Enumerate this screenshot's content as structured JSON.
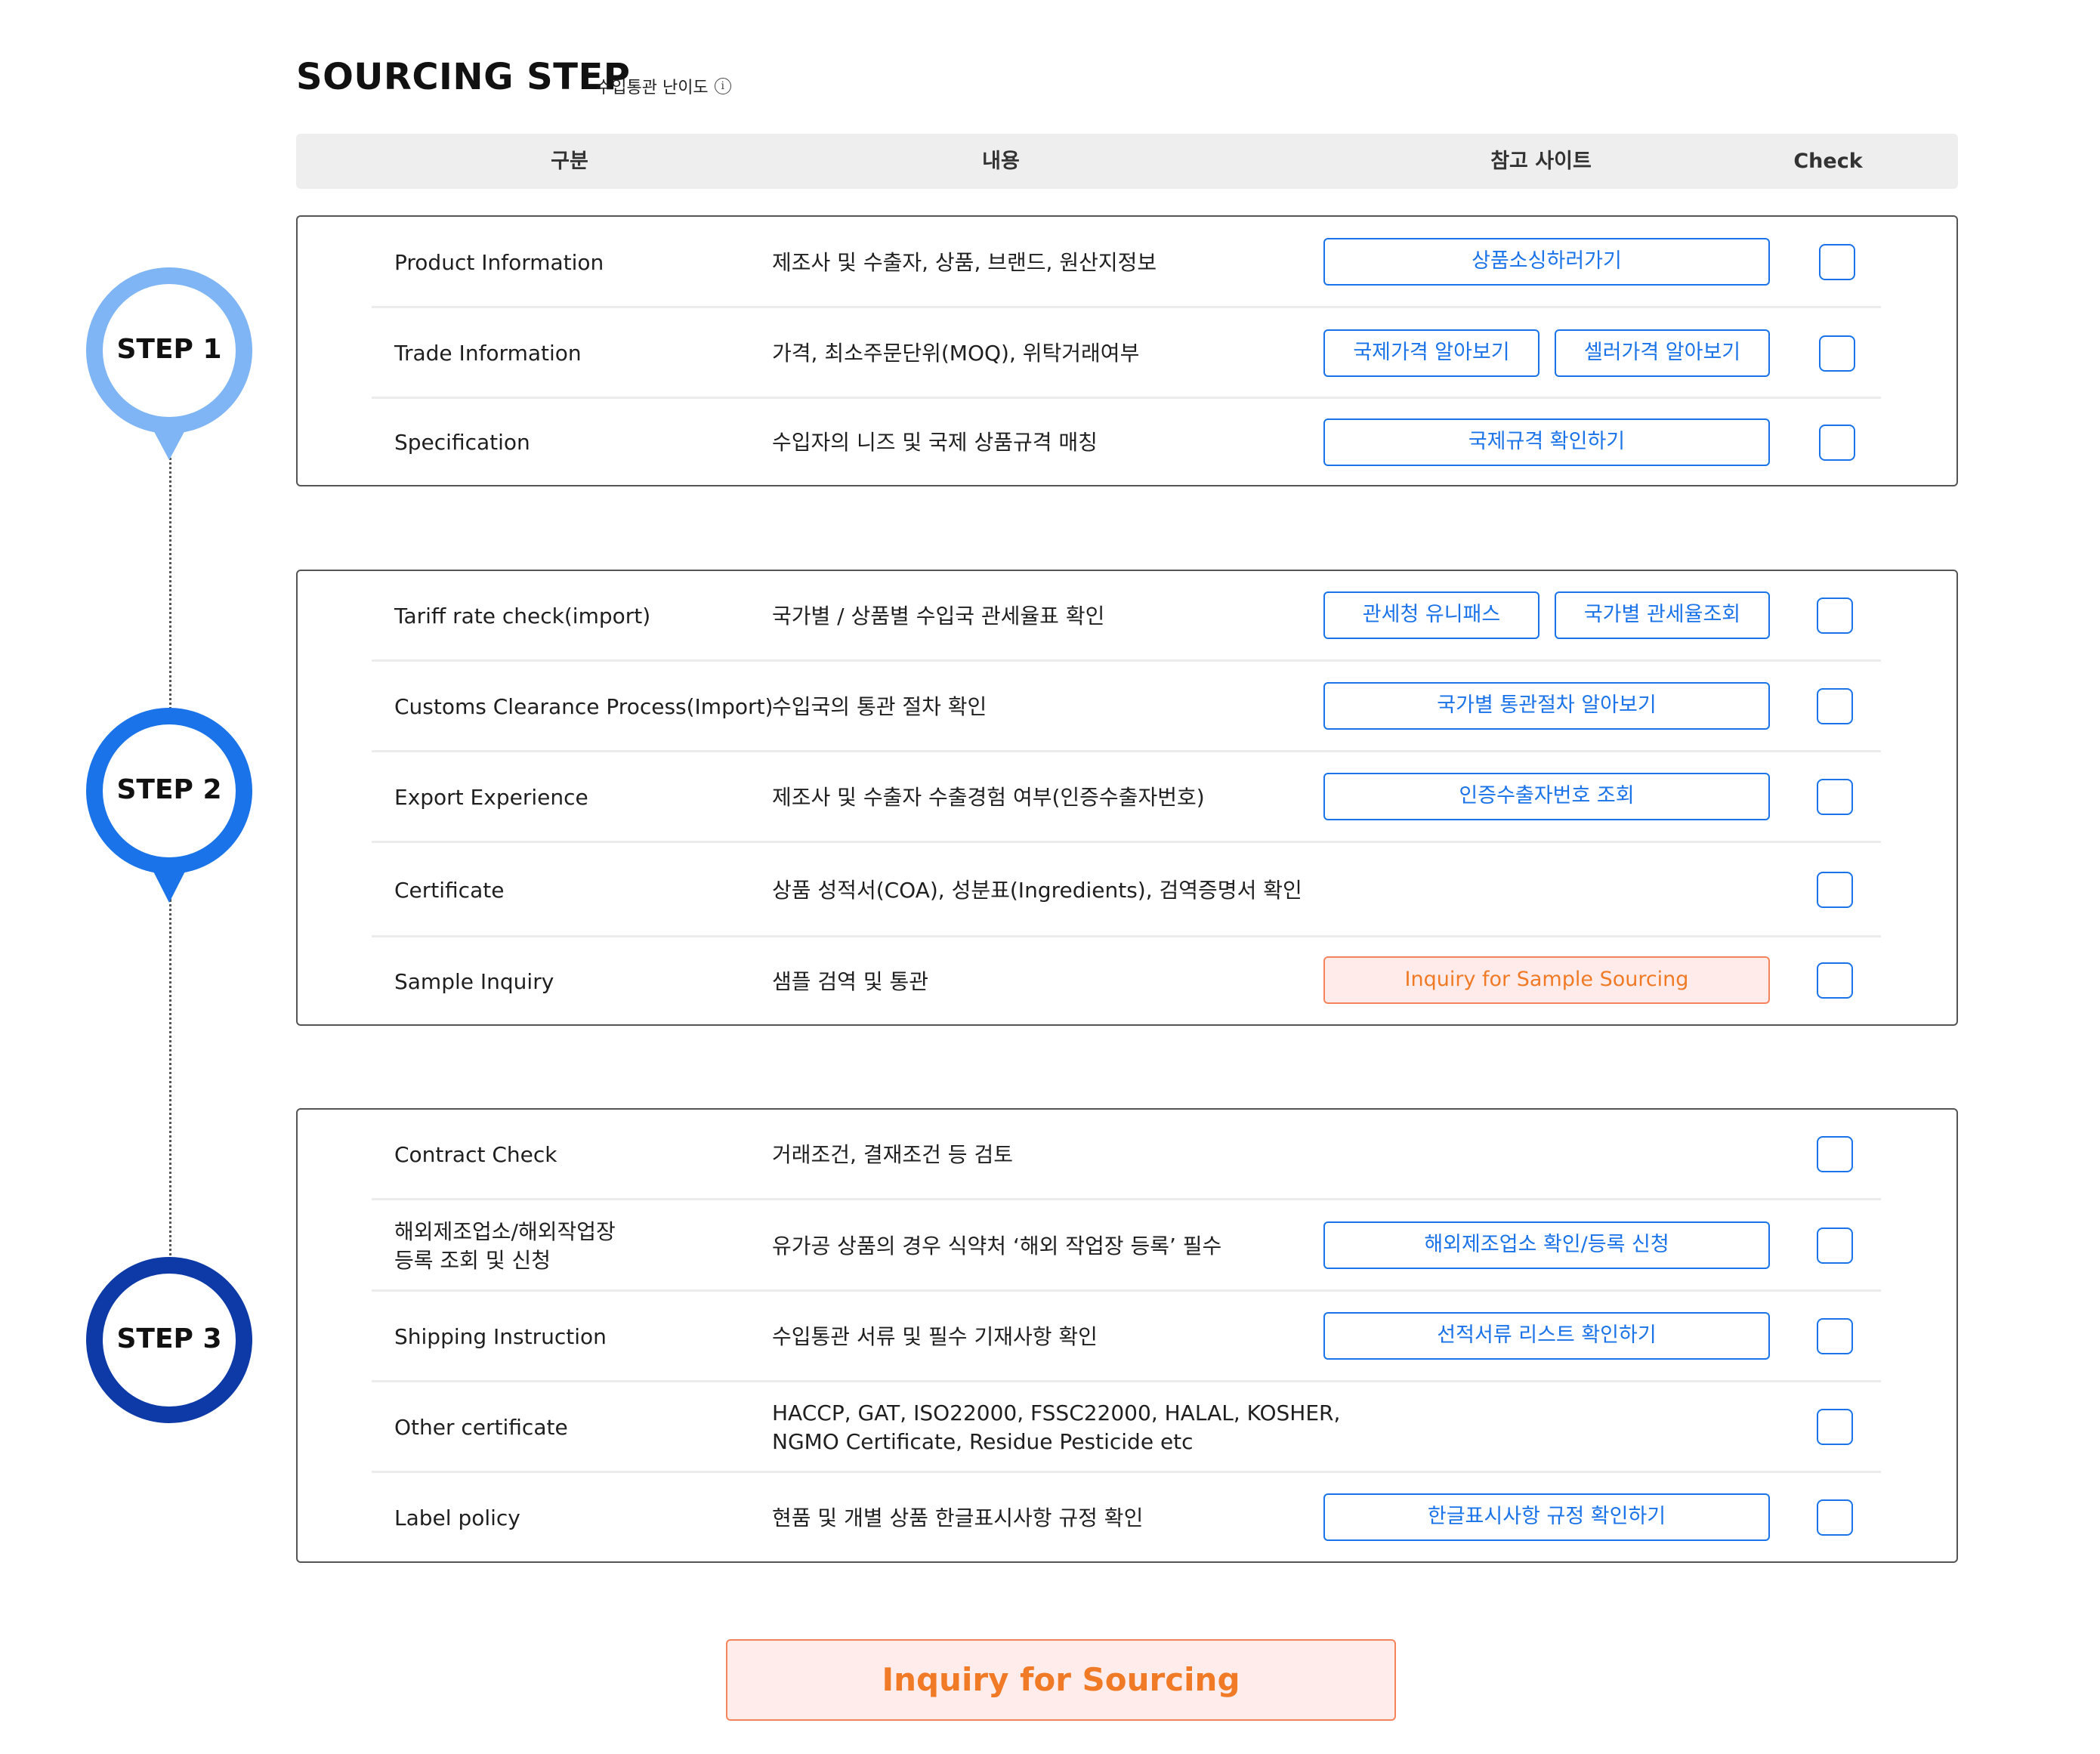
{
  "title": "SOURCING STEP",
  "subtitle": "수입통관 난이도",
  "info_icon_glyph": "i",
  "table_headers": {
    "category": "구분",
    "content": "내용",
    "reference": "참고 사이트",
    "check": "Check"
  },
  "steps": [
    {
      "label": "STEP 1",
      "color": "#7fb5f5",
      "rows": [
        {
          "label": "Product Information",
          "content": "제조사 및 수출자, 상품, 브랜드, 원산지정보",
          "buttons": [
            "상품소싱하러가기"
          ]
        },
        {
          "label": "Trade Information",
          "content": "가격, 최소주문단위(MOQ), 위탁거래여부",
          "buttons": [
            "국제가격 알아보기",
            "셀러가격 알아보기"
          ]
        },
        {
          "label": "Specification",
          "content": "수입자의 니즈 및 국제 상품규격 매칭",
          "buttons": [
            "국제규격 확인하기"
          ]
        }
      ]
    },
    {
      "label": "STEP 2",
      "color": "#1a73e8",
      "rows": [
        {
          "label": "Tariff rate check(import)",
          "content": "국가별 / 상품별 수입국 관세율표 확인",
          "buttons": [
            "관세청 유니패스",
            "국가별 관세율조회"
          ]
        },
        {
          "label": "Customs Clearance Process(Import)",
          "content": "수입국의 통관 절차 확인",
          "buttons": [
            "국가별 통관절차 알아보기"
          ]
        },
        {
          "label": "Export Experience",
          "content": "제조사 및 수출자 수출경험 여부(인증수출자번호)",
          "buttons": [
            "인증수출자번호 조회"
          ]
        },
        {
          "label": "Certificate",
          "content": "상품 성적서(COA), 성분표(Ingredients), 검역증명서 확인",
          "buttons": []
        },
        {
          "label": "Sample Inquiry",
          "content": "샘플 검역 및 통관",
          "buttons": [
            "Inquiry for Sample Sourcing"
          ]
        }
      ]
    },
    {
      "label": "STEP 3",
      "color": "#0d3aa6",
      "rows": [
        {
          "label": "Contract Check",
          "content": "거래조건, 결재조건 등 검토",
          "buttons": []
        },
        {
          "label": "해외제조업소/해외작업장\n등록 조회 및 신청",
          "content": "유가공 상품의 경우 식약처 ‘해외 작업장 등록’ 필수",
          "buttons": [
            "해외제조업소 확인/등록 신청"
          ]
        },
        {
          "label": "Shipping Instruction",
          "content": "수입통관 서류 및 필수 기재사항 확인",
          "buttons": [
            "선적서류 리스트 확인하기"
          ]
        },
        {
          "label": "Other certificate",
          "content": "HACCP, GAT, ISO22000, FSSC22000, HALAL, KOSHER,\n NGMO Certificate, Residue Pesticide etc",
          "buttons": []
        },
        {
          "label": "Label policy",
          "content": "현품 및 개별 상품 한글표시사항 규정 확인",
          "buttons": [
            "한글표시사항 규정 확인하기"
          ]
        }
      ]
    }
  ],
  "main_button": "Inquiry for Sourcing",
  "colors": {
    "accent_blue": "#1a73e8",
    "accent_orange": "#f07a26",
    "orange_bg": "#ffecea"
  }
}
